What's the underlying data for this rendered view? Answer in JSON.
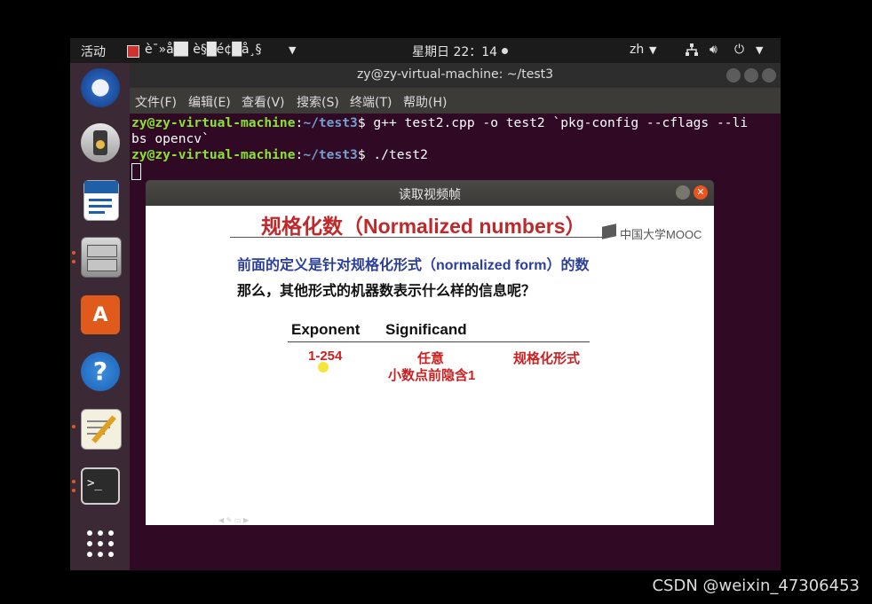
{
  "topbar": {
    "activities": "活动",
    "app_menu": "è¯»å█▌è§█é¢█å¸§",
    "clock": "星期日 22：14",
    "lang": "zh"
  },
  "terminal": {
    "title": "zy@zy-virtual-machine: ~/test3",
    "menu": [
      "文件(F)",
      "编辑(E)",
      "查看(V)",
      "搜索(S)",
      "终端(T)",
      "帮助(H)"
    ],
    "lines": [
      {
        "user": "zy@zy-virtual-machine",
        "sep": ":",
        "path": "~/test3",
        "cmd": "$ g++ test2.cpp -o test2 `pkg-config --cflags --li"
      },
      {
        "user": "",
        "sep": "",
        "path": "",
        "cmd": "bs opencv`"
      },
      {
        "user": "zy@zy-virtual-machine",
        "sep": ":",
        "path": "~/test3",
        "cmd": "$ ./test2"
      }
    ]
  },
  "video_window": {
    "title": "读取视频帧"
  },
  "slide": {
    "heading": "规格化数（Normalized numbers）",
    "logo": "中国大学MOOC",
    "line1": "前面的定义是针对规格化形式（normalized form）的数",
    "line2": "那么，其他形式的机器数表示什么样的信息呢？",
    "col_exponent": "Exponent",
    "col_significand": "Significand",
    "cell_exponent": "1-254",
    "cell_significand_1": "任意",
    "cell_significand_2": "小数点前隐含1",
    "cell_meaning": "规格化形式",
    "colors": {
      "heading": "#c0282a",
      "blue_text": "#2b3f9a",
      "red_text": "#cc1f1f"
    }
  },
  "watermark": "CSDN @weixin_47306453"
}
